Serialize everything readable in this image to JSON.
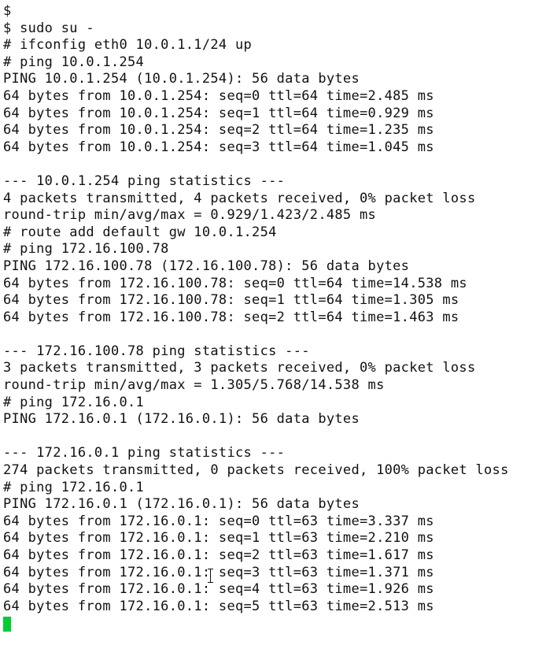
{
  "terminal": {
    "lines": [
      "$",
      "$ sudo su -",
      "# ifconfig eth0 10.0.1.1/24 up",
      "# ping 10.0.1.254",
      "PING 10.0.1.254 (10.0.1.254): 56 data bytes",
      "64 bytes from 10.0.1.254: seq=0 ttl=64 time=2.485 ms",
      "64 bytes from 10.0.1.254: seq=1 ttl=64 time=0.929 ms",
      "64 bytes from 10.0.1.254: seq=2 ttl=64 time=1.235 ms",
      "64 bytes from 10.0.1.254: seq=3 ttl=64 time=1.045 ms",
      "",
      "--- 10.0.1.254 ping statistics ---",
      "4 packets transmitted, 4 packets received, 0% packet loss",
      "round-trip min/avg/max = 0.929/1.423/2.485 ms",
      "# route add default gw 10.0.1.254",
      "# ping 172.16.100.78",
      "PING 172.16.100.78 (172.16.100.78): 56 data bytes",
      "64 bytes from 172.16.100.78: seq=0 ttl=64 time=14.538 ms",
      "64 bytes from 172.16.100.78: seq=1 ttl=64 time=1.305 ms",
      "64 bytes from 172.16.100.78: seq=2 ttl=64 time=1.463 ms",
      "",
      "--- 172.16.100.78 ping statistics ---",
      "3 packets transmitted, 3 packets received, 0% packet loss",
      "round-trip min/avg/max = 1.305/5.768/14.538 ms",
      "# ping 172.16.0.1",
      "PING 172.16.0.1 (172.16.0.1): 56 data bytes",
      "",
      "--- 172.16.0.1 ping statistics ---",
      "274 packets transmitted, 0 packets received, 100% packet loss",
      "# ping 172.16.0.1",
      "PING 172.16.0.1 (172.16.0.1): 56 data bytes",
      "64 bytes from 172.16.0.1: seq=0 ttl=63 time=3.337 ms",
      "64 bytes from 172.16.0.1: seq=1 ttl=63 time=2.210 ms",
      "64 bytes from 172.16.0.1: seq=2 ttl=63 time=1.617 ms",
      "64 bytes from 172.16.0.1: seq=3 ttl=63 time=1.371 ms",
      "64 bytes from 172.16.0.1: seq=4 ttl=63 time=1.926 ms",
      "64 bytes from 172.16.0.1: seq=5 ttl=63 time=2.513 ms"
    ],
    "cursor_color": "#00cc33",
    "text_color": "#111111",
    "background_color": "#ffffff"
  }
}
